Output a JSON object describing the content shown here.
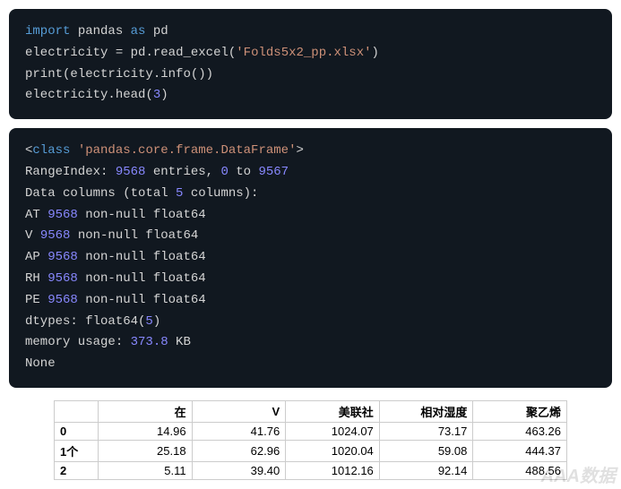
{
  "code": {
    "kw_import": "import",
    "mod_pandas": "pandas",
    "kw_as": "as",
    "alias_pd": "pd",
    "var_elec": "electricity",
    "eq": " = ",
    "pd_dot": "pd.",
    "fn_read_excel": "read_excel",
    "open_paren": "(",
    "close_paren": ")",
    "str_file": "'Folds5x2_pp.xlsx'",
    "fn_print": "print",
    "dot_info": ".info()",
    "dot_head": ".head",
    "num_3": "3"
  },
  "output": {
    "lt": "<",
    "kw_class": "class",
    "class_str": "'pandas.core.frame.DataFrame'",
    "gt": ">",
    "rangeindex_pre": "RangeIndex: ",
    "n_entries": "9568",
    "entries_mid": " entries, ",
    "zero": "0",
    "to": " to ",
    "max_idx": "9567",
    "datacols_pre": "Data columns (total ",
    "n_cols": "5",
    "datacols_post": " columns):",
    "col_at": "AT ",
    "col_v": "V ",
    "col_ap": "AP ",
    "col_rh": "RH ",
    "col_pe": "PE ",
    "nonnull_count": "9568",
    "nonnull_suffix": " non-null float64",
    "dtypes_pre": "dtypes: float64(",
    "dtypes_n": "5",
    "dtypes_post": ")",
    "mem_pre": "memory usage: ",
    "mem_val": "373.8",
    "mem_unit": " KB",
    "none": "None"
  },
  "table": {
    "headers": {
      "blank": "",
      "c1": "在",
      "c2": "V",
      "c3": "美联社",
      "c4": "相对湿度",
      "c5": "聚乙烯"
    },
    "rows": [
      {
        "idx": "0",
        "c1": "14.96",
        "c2": "41.76",
        "c3": "1024.07",
        "c4": "73.17",
        "c5": "463.26"
      },
      {
        "idx": "1个",
        "c1": "25.18",
        "c2": "62.96",
        "c3": "1020.04",
        "c4": "59.08",
        "c5": "444.37"
      },
      {
        "idx": "2",
        "c1": "5.11",
        "c2": "39.40",
        "c3": "1012.16",
        "c4": "92.14",
        "c5": "488.56"
      }
    ]
  },
  "watermark": "AAA数据"
}
